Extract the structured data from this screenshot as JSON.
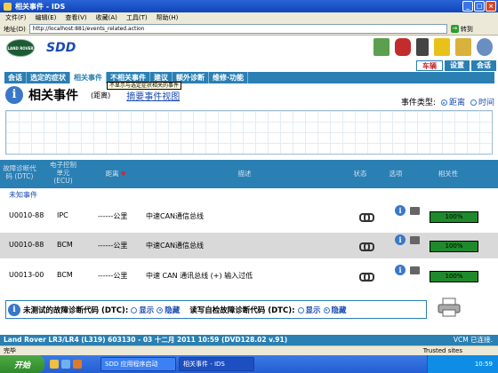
{
  "window": {
    "title": "相关事件 - IDS"
  },
  "menu": [
    "文件(F)",
    "编辑(E)",
    "查看(V)",
    "收藏(A)",
    "工具(T)",
    "帮助(H)"
  ],
  "toolbar": {
    "address_label": "地址(D)",
    "url": "http://localhost:881/events_related.action",
    "go_label": "转到"
  },
  "header": {
    "logo_text": "LAND ROVER",
    "app_name": "SDD"
  },
  "right_tabs": [
    "车辆",
    "设置",
    "会话"
  ],
  "nav_tabs": [
    "会话",
    "选定的症状",
    "相关事件",
    "不相关事件",
    "建议",
    "额外诊断",
    "维修·功能"
  ],
  "tooltip": "不显示与选定症状相关的事件",
  "section": {
    "title": "相关事件",
    "distance_label": "(距离)",
    "summary_link": "摘要事件视图"
  },
  "event_type": {
    "label": "事件类型:",
    "options": [
      "距离",
      "时间"
    ],
    "selected": "距离"
  },
  "table": {
    "headers": [
      "故障诊断代码 (DTC)",
      "电子控制单元 (ECU)",
      "距离",
      "描述",
      "状态",
      "选项",
      "相关性"
    ],
    "group_label": "未知事件",
    "rows": [
      {
        "dtc": "U0010-88",
        "ecu": "IPC",
        "distance": "------公里",
        "description": "中速CAN通信总线",
        "relevance": "100%"
      },
      {
        "dtc": "U0010-88",
        "ecu": "BCM",
        "distance": "------公里",
        "description": "中速CAN通信总线",
        "relevance": "100%"
      },
      {
        "dtc": "U0013-00",
        "ecu": "BCM",
        "distance": "------公里",
        "description": "中速 CAN 通讯总线 (+) 输入过低",
        "relevance": "100%"
      }
    ]
  },
  "filters": {
    "untested_label": "未测试的故障诊断代码 (DTC):",
    "self_test_label": "读写自检故障诊断代码 (DTC):",
    "show": "显示",
    "hide": "隐藏"
  },
  "app_status": {
    "vehicle": "Land Rover LR3/LR4 (L319) 603130 - 03 十二月 2011 10:59 (DVD128.02 v.91)",
    "vcm": "VCM 已连接."
  },
  "ie_status": {
    "left": "完毕",
    "zone": "Trusted sites"
  },
  "taskbar": {
    "start": "开始",
    "tasks": [
      "SDD 应用程序启动",
      "相关事件 - IDS"
    ],
    "clock": "10:59"
  },
  "colors": {
    "accent": "#2a7fb3",
    "link": "#1a4bb2",
    "relevance_fill": "#1f8a2b"
  }
}
